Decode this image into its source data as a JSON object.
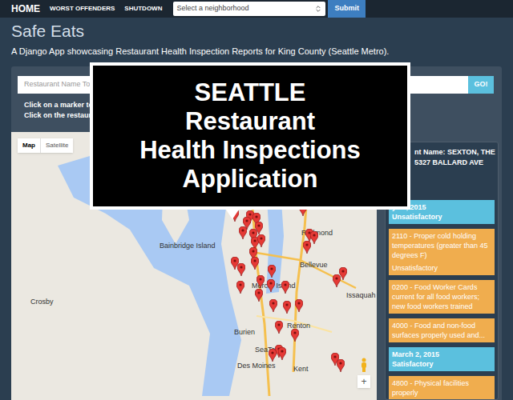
{
  "nav": {
    "brand": "HOME",
    "links": [
      "WORST OFFENDERS",
      "SHUTDOWN"
    ],
    "select": {
      "placeholder": "Select a neighborhood"
    },
    "submit": "Submit"
  },
  "header": {
    "title": "Safe Eats",
    "subtitle": "A Django App showcasing Restaurant Health Inspection Reports for King County (Seattle Metro)."
  },
  "search": {
    "placeholder": "Restaurant Name To Se",
    "button": "GO!"
  },
  "instructions": [
    "Click on a marker to vie",
    "Click on the restaurant"
  ],
  "map": {
    "types": [
      {
        "label": "Map",
        "selected": true
      },
      {
        "label": "Satellite",
        "selected": false
      }
    ],
    "places": [
      "Redmond",
      "Bainbridge Island",
      "Bellevue",
      "Mercer Island",
      "Issaquah",
      "Crosby",
      "Burien",
      "Renton",
      "SeaTac",
      "Des Moines",
      "Kent"
    ],
    "zoom": "+"
  },
  "details": {
    "name": "nt Name: SEXTON, THE",
    "address": "5327 BALLARD AVE",
    "entries": [
      {
        "kind": "inspection",
        "date": "y 17, 2015",
        "result": "Unsatisfactory"
      },
      {
        "kind": "violation",
        "text": "2110 - Proper cold holding temperatures (greater than 45 degrees F)",
        "result": "Unsatisfactory"
      },
      {
        "kind": "violation",
        "text": "0200 - Food Worker Cards current for all food workers; new food workers trained"
      },
      {
        "kind": "violation",
        "text": "4000 - Food and non-food surfaces properly used and..."
      },
      {
        "kind": "inspection",
        "date": "March 2, 2015",
        "result": "Satisfactory"
      },
      {
        "kind": "violation",
        "text": "4800 - Physical facilities properly"
      }
    ]
  },
  "overlay": {
    "lines": [
      "SEATTLE",
      "Restaurant",
      "Health Inspections",
      "Application"
    ]
  }
}
